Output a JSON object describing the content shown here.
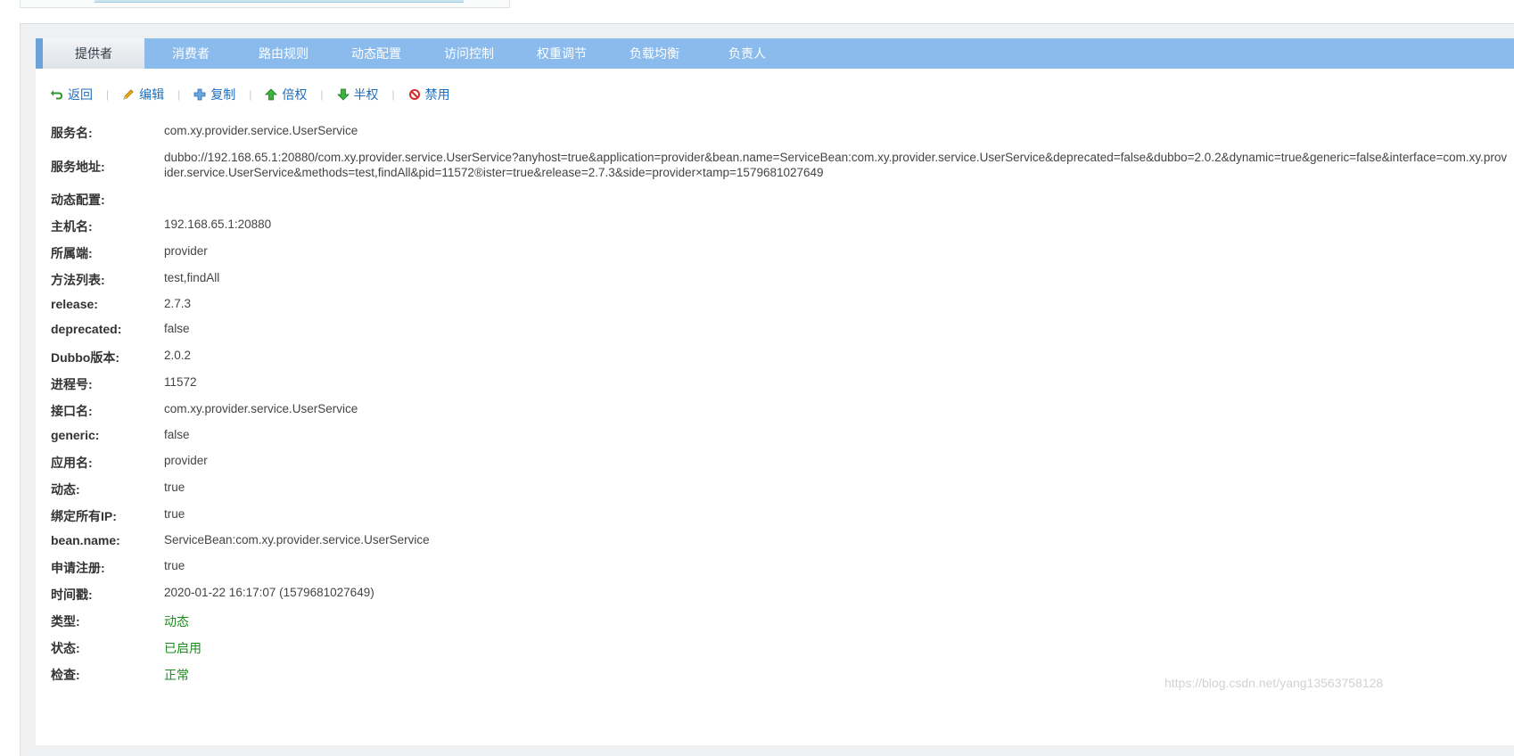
{
  "tabs": [
    {
      "label": "提供者",
      "active": true
    },
    {
      "label": "消费者"
    },
    {
      "label": "路由规则"
    },
    {
      "label": "动态配置"
    },
    {
      "label": "访问控制"
    },
    {
      "label": "权重调节"
    },
    {
      "label": "负载均衡"
    },
    {
      "label": "负责人"
    }
  ],
  "toolbar": {
    "back": {
      "label": "返回",
      "icon": "return-arrow-icon"
    },
    "edit": {
      "label": "编辑",
      "icon": "pencil-icon"
    },
    "copy": {
      "label": "复制",
      "icon": "plus-icon"
    },
    "double_weight": {
      "label": "倍权",
      "icon": "arrow-up-icon"
    },
    "half_weight": {
      "label": "半权",
      "icon": "arrow-down-icon"
    },
    "disable": {
      "label": "禁用",
      "icon": "ban-icon"
    },
    "separator": "|"
  },
  "details": [
    {
      "label": "服务名:",
      "value": "com.xy.provider.service.UserService"
    },
    {
      "label": "服务地址:",
      "value": "dubbo://192.168.65.1:20880/com.xy.provider.service.UserService?anyhost=true&application=provider&bean.name=ServiceBean:com.xy.provider.service.UserService&deprecated=false&dubbo=2.0.2&dynamic=true&generic=false&interface=com.xy.prov",
      "value2": "ider.service.UserService&methods=test,findAll&pid=11572®ister=true&release=2.7.3&side=provider×tamp=1579681027649"
    },
    {
      "label": "动态配置:",
      "value": ""
    },
    {
      "label": "主机名:",
      "value": "192.168.65.1:20880"
    },
    {
      "label": "所属端:",
      "value": "provider"
    },
    {
      "label": "方法列表:",
      "value": "test,findAll"
    },
    {
      "label": "release:",
      "value": "2.7.3"
    },
    {
      "label": "deprecated:",
      "value": "false"
    },
    {
      "label": "Dubbo版本:",
      "value": "2.0.2"
    },
    {
      "label": "进程号:",
      "value": "11572"
    },
    {
      "label": "接口名:",
      "value": "com.xy.provider.service.UserService"
    },
    {
      "label": "generic:",
      "value": "false"
    },
    {
      "label": "应用名:",
      "value": "provider"
    },
    {
      "label": "动态:",
      "value": "true"
    },
    {
      "label": "绑定所有IP:",
      "value": "true"
    },
    {
      "label": "bean.name:",
      "value": "ServiceBean:com.xy.provider.service.UserService"
    },
    {
      "label": "申请注册:",
      "value": "true"
    },
    {
      "label": "时间戳:",
      "value": "2020-01-22 16:17:07 (1579681027649)"
    },
    {
      "label": "类型:",
      "value": "动态"
    },
    {
      "label": "状态:",
      "value": "已启用"
    },
    {
      "label": "检查:",
      "value": "正常"
    }
  ],
  "colors": {
    "tab_bar": "#8bbbec",
    "link": "#1f6fbd",
    "status_green": "#1d8a1d"
  },
  "watermark": "https://blog.csdn.net/yang13563758128"
}
